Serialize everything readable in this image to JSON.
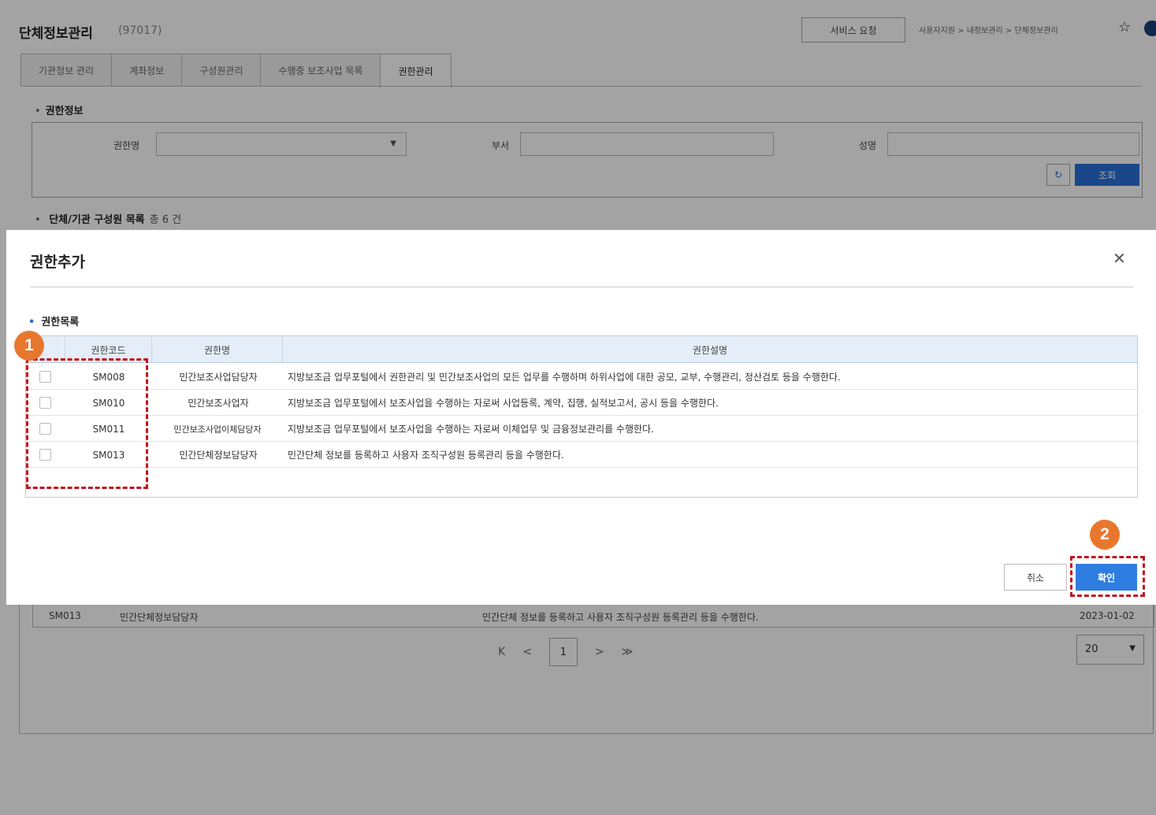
{
  "page": {
    "title": "단체정보관리",
    "code": "(97017)",
    "service_button": "서비스 요청",
    "breadcrumb": "사용자지원 > 내정보관리 > 단체정보관리",
    "tabs": [
      "기관정보 관리",
      "계좌정보",
      "구성원관리",
      "수행중 보조사업 목록",
      "권한관리"
    ],
    "active_tab": "권한관리",
    "auth_section_title": "권한정보",
    "fields": {
      "role_label": "권한명",
      "dept_label": "부서",
      "name_label": "성명"
    },
    "search_button": "조회",
    "reset_icon": "refresh-icon",
    "members_title": "단체/기관 구성원 목록",
    "members_count": "총 6 건",
    "member_row": {
      "code": "SM013",
      "name": "민간단체정보담당자",
      "desc": "민간단체 정보를 등록하고 사용자 조직구성원 등록관리 등을 수행한다.",
      "date": "2023-01-02"
    },
    "pager": {
      "first": "K",
      "prev": "<",
      "current": "1",
      "next": ">",
      "last": "≫"
    },
    "page_size": "20"
  },
  "modal": {
    "title": "권한추가",
    "close_icon": "close-icon",
    "list_title": "권한목록",
    "columns": {
      "code": "권한코드",
      "name": "권한명",
      "desc": "권한설명"
    },
    "rows": [
      {
        "code": "SM008",
        "name": "민간보조사업담당자",
        "desc": "지방보조금 업무포털에서 권한관리 및 민간보조사업의 모든 업무를 수행하며 하위사업에 대한 공모, 교부, 수행관리, 정산검토 등을 수행한다."
      },
      {
        "code": "SM010",
        "name": "민간보조사업자",
        "desc": "지방보조금 업무포털에서 보조사업을 수행하는 자로써 사업등록, 계약, 집행, 실적보고서, 공시 등을 수행한다."
      },
      {
        "code": "SM011",
        "name": "민간보조사업이체담당자",
        "desc": "지방보조금 업무포털에서 보조사업을 수행하는 자로써 이체업무 및 금융정보관리를 수행한다."
      },
      {
        "code": "SM013",
        "name": "민간단체정보담당자",
        "desc": "민간단체 정보를 등록하고 사용자 조직구성원 등록관리 등을 수행한다."
      }
    ],
    "cancel_button": "취소",
    "confirm_button": "확인"
  },
  "annotations": {
    "step1": "1",
    "step2": "2"
  },
  "colors": {
    "primary": "#2f7de1",
    "callout": "#e8772e",
    "highlight": "#c0161d"
  }
}
